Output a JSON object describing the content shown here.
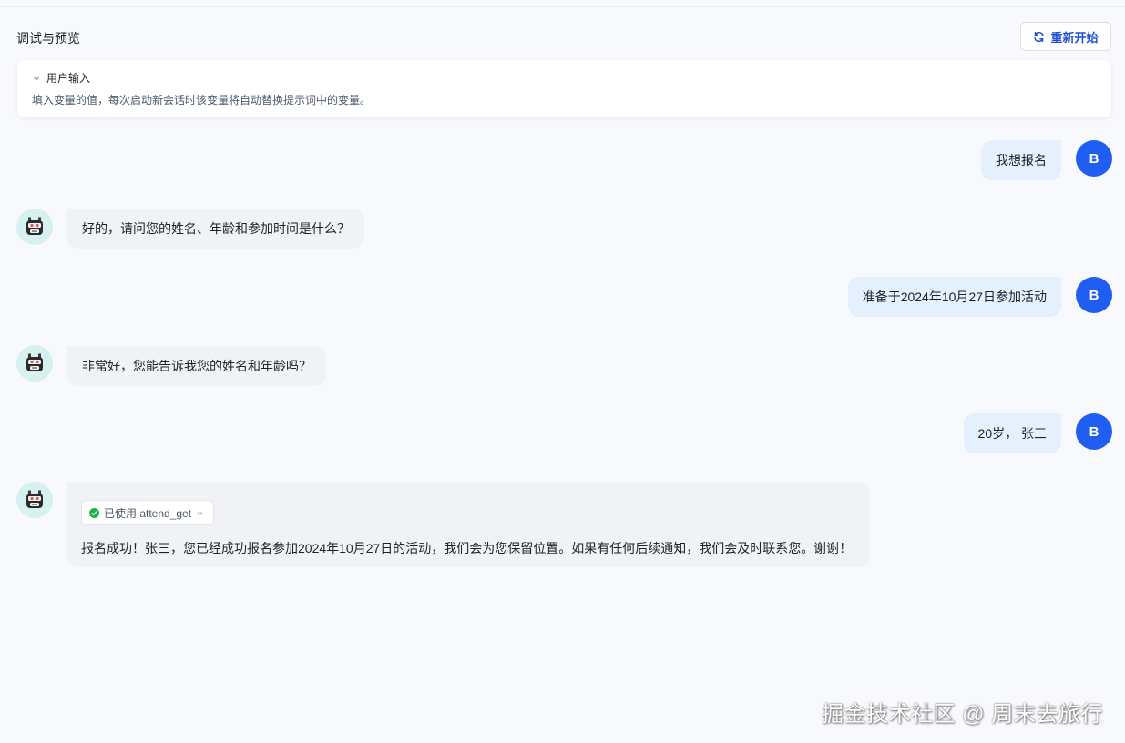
{
  "header": {
    "title": "调试与预览",
    "restart_label": "重新开始"
  },
  "variables": {
    "label": "用户输入",
    "description": "填入变量的值，每次启动新会话时该变量将自动替换提示词中的变量。"
  },
  "user": {
    "initial": "B"
  },
  "messages": [
    {
      "role": "user",
      "text": "我想报名"
    },
    {
      "role": "bot",
      "text": "好的，请问您的姓名、年龄和参加时间是什么？"
    },
    {
      "role": "user",
      "text": "准备于2024年10月27日参加活动"
    },
    {
      "role": "bot",
      "text": "非常好，您能告诉我您的姓名和年龄吗？"
    },
    {
      "role": "user",
      "text": "20岁， 张三"
    },
    {
      "role": "bot",
      "tool": "已使用 attend_get",
      "text": "报名成功！张三，您已经成功报名参加2024年10月27日的活动，我们会为您保留位置。如果有任何后续通知，我们会及时联系您。谢谢！"
    }
  ],
  "watermark": "掘金技术社区 @ 周末去旅行",
  "colors": {
    "accent": "#1f5ef0",
    "user_bubble": "#e5f0fe",
    "bot_bubble": "#f0f2f6",
    "bot_avatar_bg": "#d6f1ef",
    "success": "#22b04b"
  },
  "icons": {
    "restart": "refresh-icon",
    "collapse": "chevron-down-icon",
    "bot": "robot-icon",
    "tool_status": "check-circle-icon"
  }
}
